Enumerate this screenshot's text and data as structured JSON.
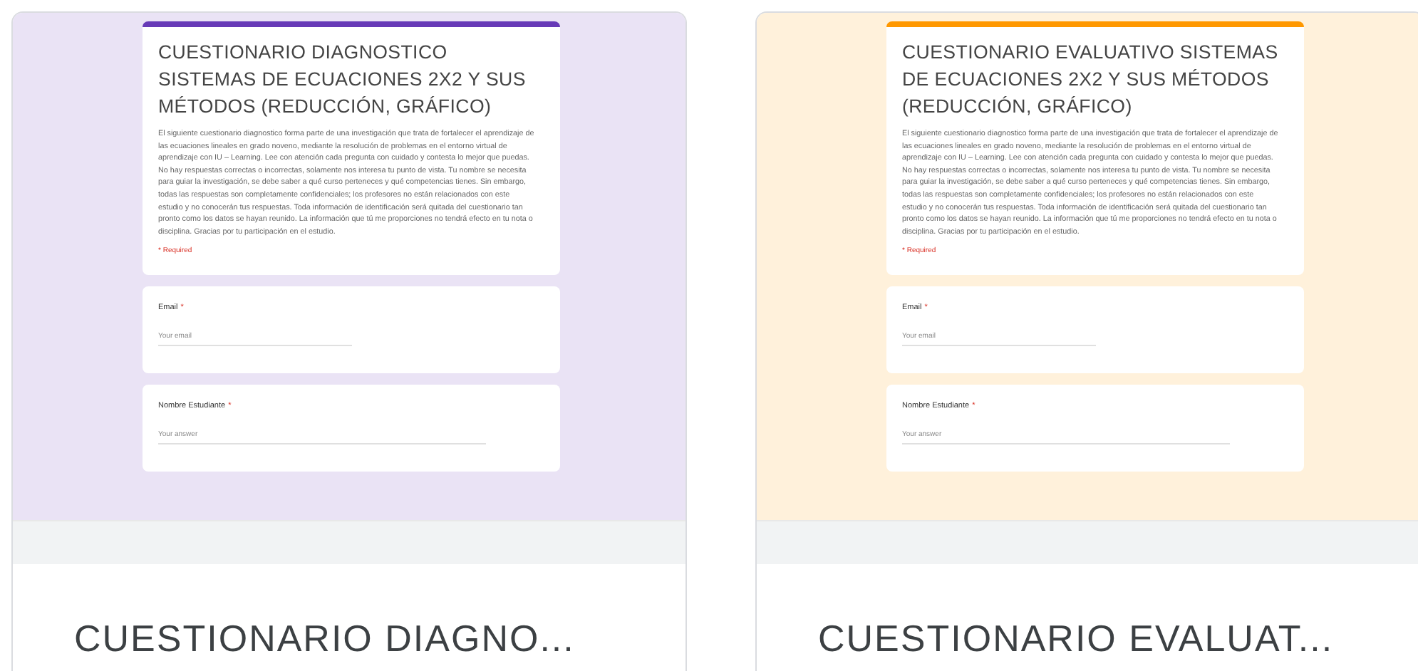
{
  "cards": [
    {
      "color": "#673ab7",
      "form": {
        "title": "CUESTIONARIO DIAGNOSTICO SISTEMAS DE ECUACIONES 2X2 Y SUS MÉTODOS (REDUCCIÓN, GRÁFICO)",
        "description": "El siguiente cuestionario diagnostico forma parte de una investigación que trata de fortalecer el aprendizaje de las ecuaciones lineales en grado noveno, mediante la resolución de problemas en el entorno virtual de aprendizaje con IU – Learning. Lee con atención cada pregunta con cuidado y contesta lo mejor que puedas. No hay respuestas correctas o incorrectas, solamente nos interesa tu punto de vista. Tu nombre se necesita para guiar la investigación, se debe saber a qué curso perteneces y qué competencias tienes. Sin embargo, todas las respuestas son completamente confidenciales; los profesores no están relacionados con este estudio y no conocerán tus respuestas. Toda información de identificación será quitada del cuestionario tan pronto como los datos se hayan reunido. La información que tú me proporciones no tendrá efecto en tu nota o disciplina. Gracias por tu participación en el estudio.",
        "required_note": "* Required",
        "questions": [
          {
            "label": "Email",
            "required_mark": "*",
            "placeholder": "Your email"
          },
          {
            "label": "Nombre Estudiante",
            "required_mark": "*",
            "placeholder": "Your answer"
          }
        ]
      },
      "name": "CUESTIONARIO DIAGNO..."
    },
    {
      "color": "#ff9800",
      "form": {
        "title": "CUESTIONARIO EVALUATIVO SISTEMAS DE ECUACIONES 2X2 Y SUS MÉTODOS (REDUCCIÓN, GRÁFICO)",
        "description": "El siguiente cuestionario diagnostico forma parte de una investigación que trata de fortalecer el aprendizaje de las ecuaciones lineales en grado noveno, mediante la resolución de problemas en el entorno virtual de aprendizaje con IU – Learning. Lee con atención cada pregunta con cuidado y contesta lo mejor que puedas. No hay respuestas correctas o incorrectas, solamente nos interesa tu punto de vista. Tu nombre se necesita para guiar la investigación, se debe saber a qué curso perteneces y qué competencias tienes. Sin embargo, todas las respuestas son completamente confidenciales; los profesores no están relacionados con este estudio y no conocerán tus respuestas. Toda información de identificación será quitada del cuestionario tan pronto como los datos se hayan reunido. La información que tú me proporciones no tendrá efecto en tu nota o disciplina. Gracias por tu participación en el estudio.",
        "required_note": "* Required",
        "questions": [
          {
            "label": "Email",
            "required_mark": "*",
            "placeholder": "Your email"
          },
          {
            "label": "Nombre Estudiante",
            "required_mark": "*",
            "placeholder": "Your answer"
          }
        ]
      },
      "name": "CUESTIONARIO EVALUAT..."
    }
  ]
}
